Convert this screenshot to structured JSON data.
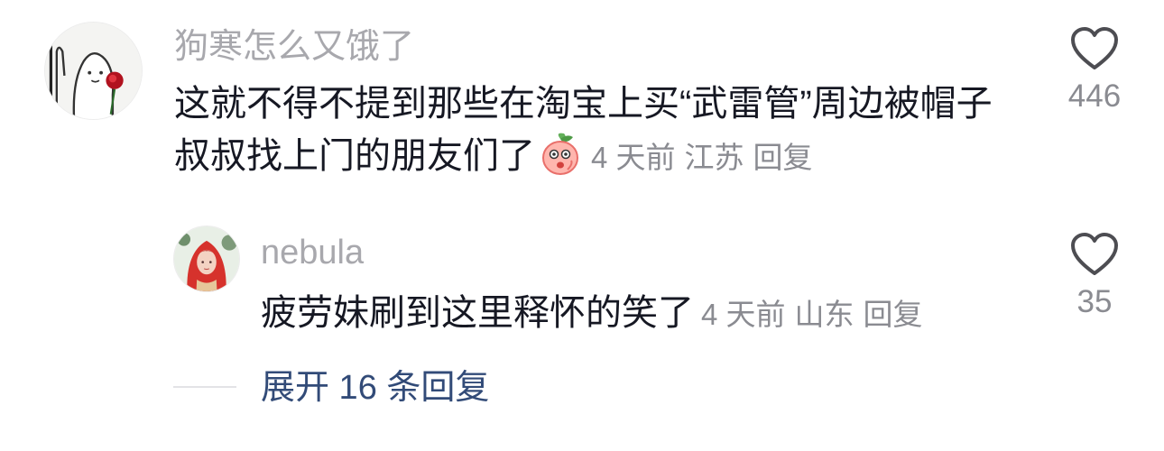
{
  "comments": [
    {
      "username": "狗寒怎么又饿了",
      "text": "这就不得不提到那些在淘宝上买“武雷管”周边被帽子叔叔找上门的朋友们了",
      "time": "4 天前",
      "location": "江苏",
      "reply_label": "回复",
      "like_count": "446",
      "icons": {
        "like": "heart-outline-icon",
        "emoji": "peach-emoji-icon"
      }
    },
    {
      "username": "nebula",
      "text": "疲劳妹刷到这里释怀的笑了",
      "time": "4 天前",
      "location": "山东",
      "reply_label": "回复",
      "like_count": "35",
      "icons": {
        "like": "heart-outline-icon"
      }
    }
  ],
  "expand_replies": {
    "label": "展开 16 条回复"
  },
  "colors": {
    "text": "#161823",
    "username": "#a8a8ad",
    "meta": "#8a8b91",
    "link": "#324b78"
  }
}
